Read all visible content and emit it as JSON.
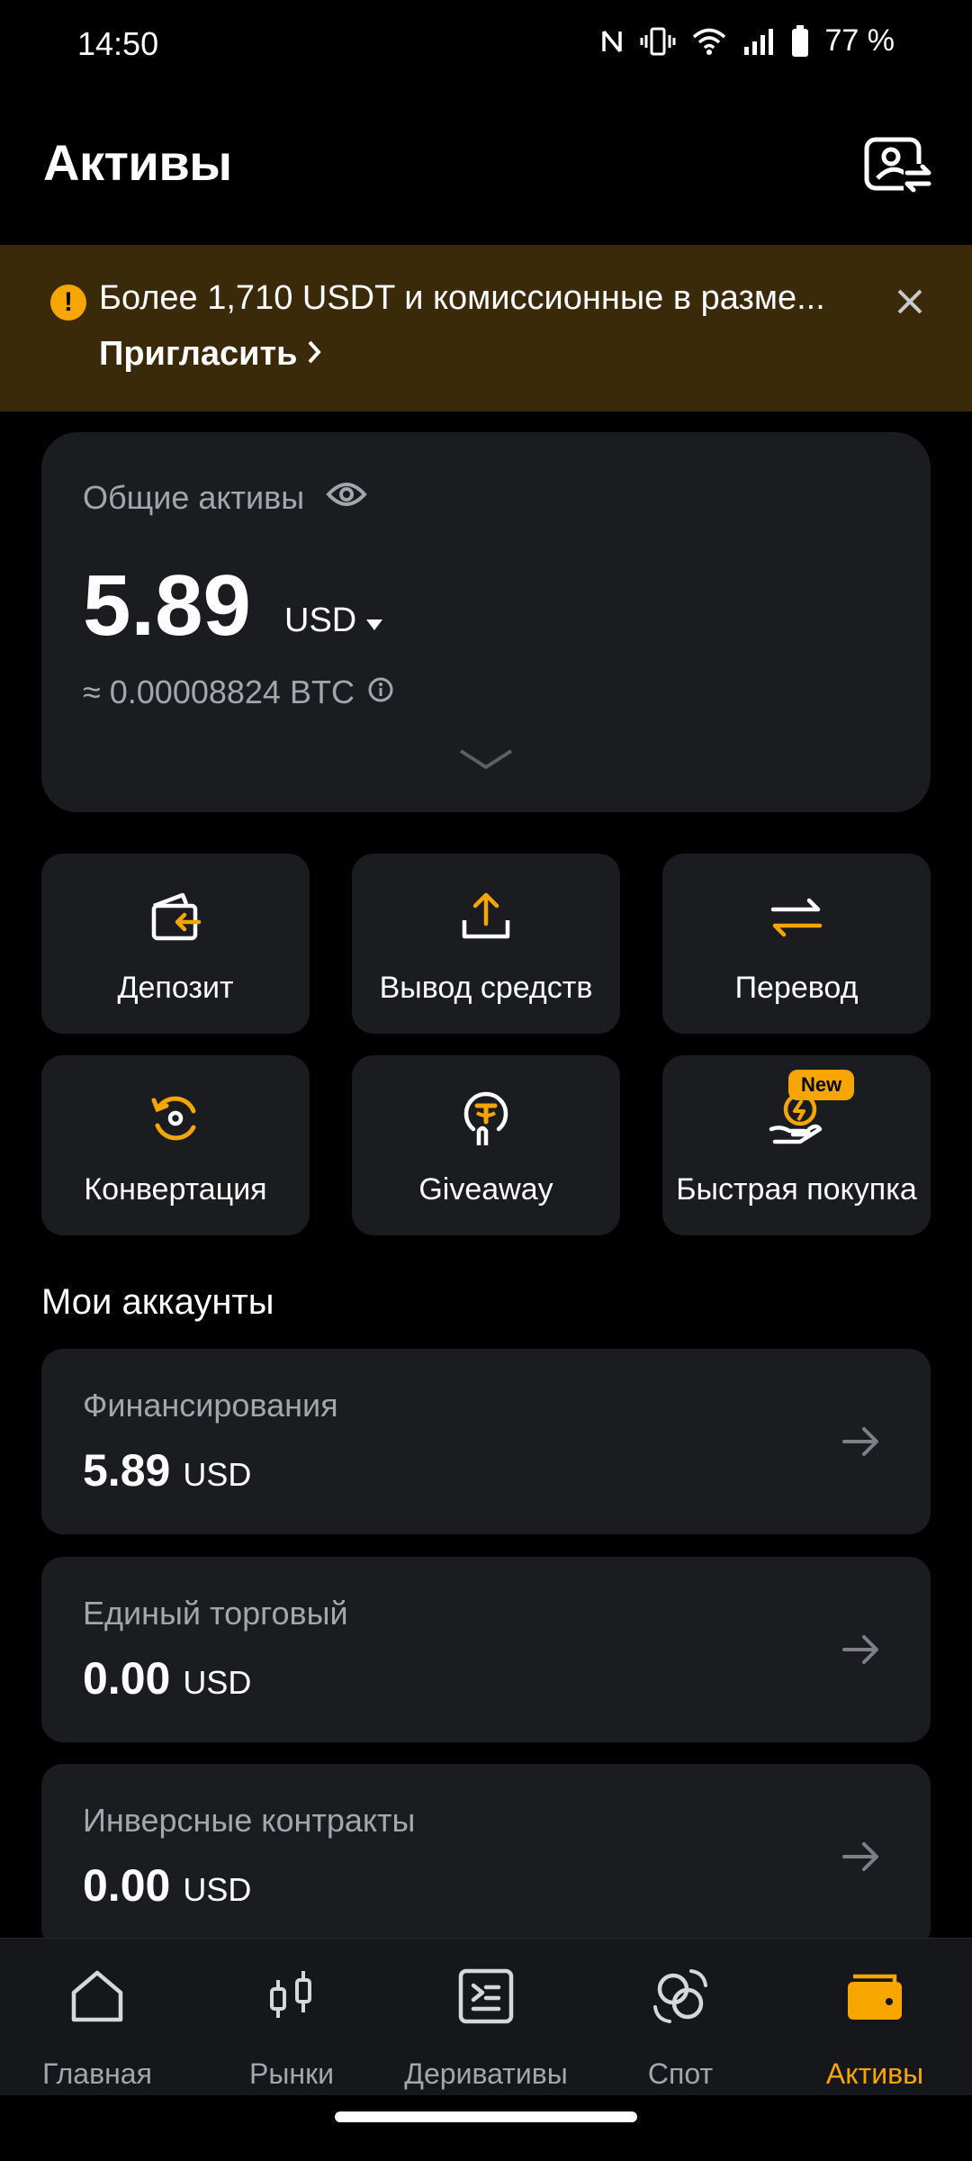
{
  "status_bar": {
    "time": "14:50",
    "battery": "77 %"
  },
  "header": {
    "title": "Активы"
  },
  "banner": {
    "text": "Более 1,710 USDT и комиссионные в разме...",
    "link": "Пригласить"
  },
  "total": {
    "label": "Общие активы",
    "value": "5.89",
    "currency": "USD",
    "btc": "≈ 0.00008824 BTC"
  },
  "actions": [
    {
      "label": "Депозит",
      "icon": "deposit-icon"
    },
    {
      "label": "Вывод средств",
      "icon": "withdraw-icon"
    },
    {
      "label": "Перевод",
      "icon": "transfer-icon"
    },
    {
      "label": "Конвертация",
      "icon": "convert-icon"
    },
    {
      "label": "Giveaway",
      "icon": "giveaway-icon"
    },
    {
      "label": "Быстрая покупка",
      "icon": "quick-buy-icon",
      "badge": "New"
    }
  ],
  "accounts_title": "Мои аккаунты",
  "accounts": [
    {
      "name": "Финансирования",
      "amount": "5.89",
      "currency": "USD"
    },
    {
      "name": "Единый торговый",
      "amount": "0.00",
      "currency": "USD"
    },
    {
      "name": "Инверсные контракты",
      "amount": "0.00",
      "currency": "USD"
    }
  ],
  "nav": [
    {
      "label": "Главная",
      "icon": "home-icon"
    },
    {
      "label": "Рынки",
      "icon": "markets-icon"
    },
    {
      "label": "Деривативы",
      "icon": "derivatives-icon"
    },
    {
      "label": "Спот",
      "icon": "spot-icon"
    },
    {
      "label": "Активы",
      "icon": "wallet-icon",
      "active": true
    }
  ],
  "colors": {
    "accent": "#f7a600",
    "background": "#000000",
    "card": "#1b1c20",
    "banner": "#3a2a0a"
  }
}
